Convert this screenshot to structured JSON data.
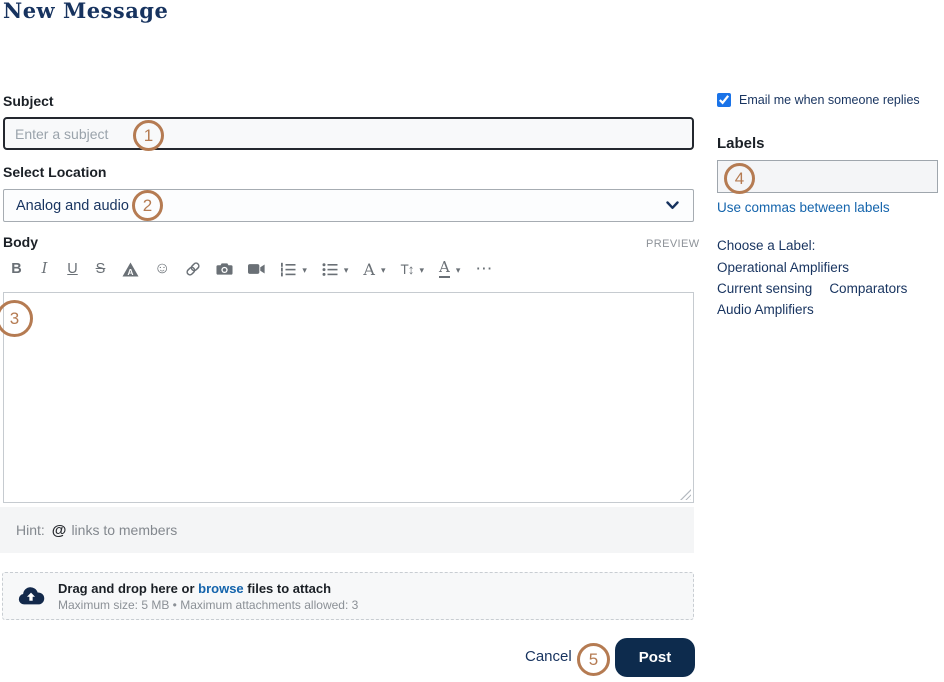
{
  "page": {
    "title": "New Message"
  },
  "colors": {
    "accent_navy": "#17335f",
    "link_blue": "#1464ac",
    "annotation_orange": "#b57b52",
    "checkbox_blue": "#1a73e8",
    "post_button_navy": "#0d2b4d"
  },
  "form": {
    "subject": {
      "label": "Subject",
      "value": "",
      "placeholder": "Enter a subject"
    },
    "location": {
      "label": "Select Location",
      "selected": "Analog and audio"
    },
    "body": {
      "label": "Body",
      "preview": "PREVIEW",
      "value": "",
      "toolbar": [
        {
          "name": "bold-icon",
          "glyph": "B"
        },
        {
          "name": "italic-icon",
          "glyph": "I"
        },
        {
          "name": "underline-icon",
          "glyph": "U"
        },
        {
          "name": "strikethrough-icon",
          "glyph": "S"
        },
        {
          "name": "spoiler-warning-icon",
          "glyph": "A"
        },
        {
          "name": "emoji-icon",
          "glyph": "☺"
        },
        {
          "name": "insert-link-icon"
        },
        {
          "name": "insert-image-icon"
        },
        {
          "name": "insert-video-icon"
        },
        {
          "name": "ordered-list-icon"
        },
        {
          "name": "unordered-list-icon"
        },
        {
          "name": "font-family-icon",
          "glyph": "A"
        },
        {
          "name": "font-size-icon",
          "glyph": "T↕"
        },
        {
          "name": "text-color-icon",
          "glyph": "A"
        },
        {
          "name": "more-options-icon",
          "glyph": "⋯"
        }
      ],
      "hint": {
        "prefix": "Hint:",
        "symbol": "@",
        "suffix": "links to members"
      }
    },
    "attachment": {
      "drag_text": "Drag and drop here or ",
      "browse_link": "browse",
      "after_text": " files to attach",
      "limits": "Maximum size: 5 MB • Maximum attachments allowed: 3"
    },
    "actions": {
      "cancel": "Cancel",
      "post": "Post"
    }
  },
  "sidebar": {
    "email_notify": {
      "label": "Email me when someone replies",
      "checked": true
    },
    "labels": {
      "heading": "Labels",
      "value": "",
      "help": "Use commas between labels",
      "choose": "Choose a Label:",
      "suggestions": [
        "Operational Amplifiers",
        "Current sensing",
        "Comparators",
        "Audio Amplifiers"
      ]
    }
  },
  "annotations": {
    "a1": "1",
    "a2": "2",
    "a3": "3",
    "a4": "4",
    "a5": "5"
  }
}
